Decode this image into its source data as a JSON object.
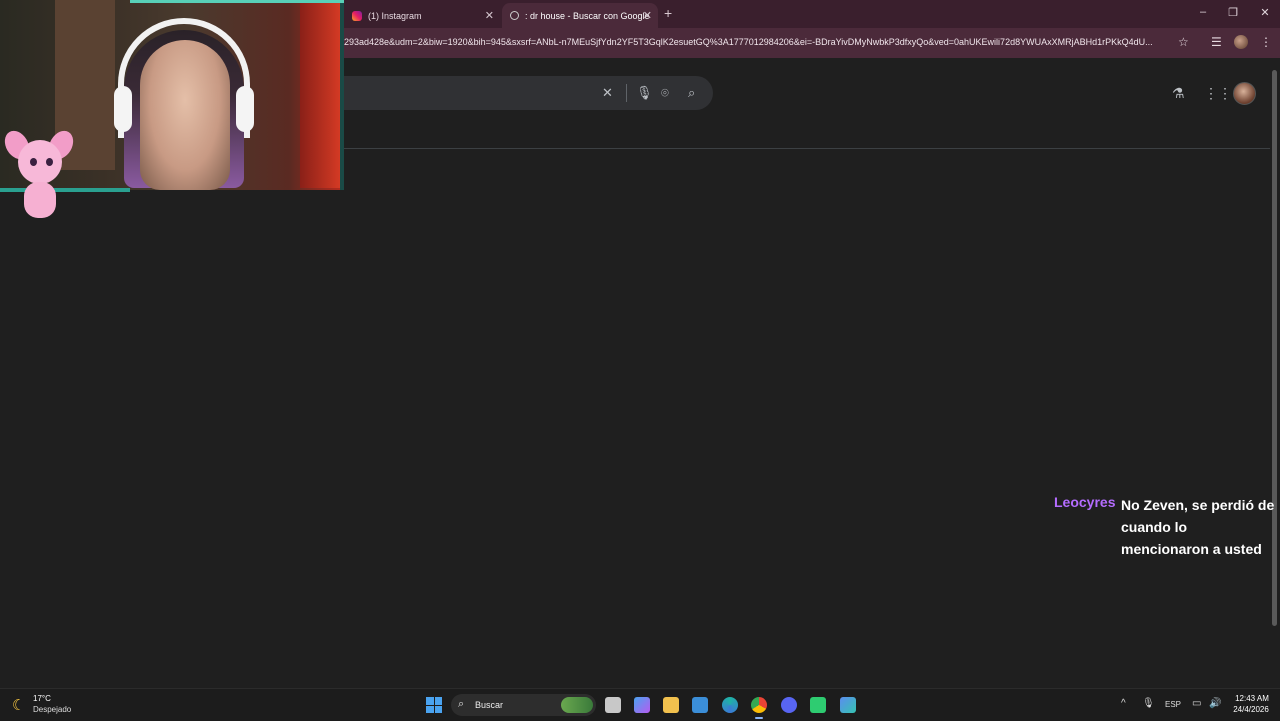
{
  "browser": {
    "tabs": [
      {
        "label": "(1) Instagram",
        "active": false
      },
      {
        "label": ": dr house - Buscar con Google",
        "active": true
      }
    ],
    "new_tab": "+",
    "url": "293ad428e&udm=2&biw=1920&bih=945&sxsrf=ANbL-n7MEuSjfYdn2YF5T3GqlK2esuetGQ%3A1777012984206&ei=-BDraYivDMyNwbkP3dfxyQo&ved=0ahUKEwili72d8YWUAxXMRjABHd1rPKkQ4dU...",
    "window_controls": {
      "minimize": "–",
      "maximize": "❐",
      "close": "✕"
    }
  },
  "search": {
    "clear_icon": "close-icon",
    "voice_icon": "mic-icon",
    "lens_icon": "camera-icon",
    "search_icon": "search-icon"
  },
  "chat": {
    "username": "Leocyres",
    "username_color": "#b46cff",
    "message_lines": [
      "No Zeven, se perdió de",
      "cuando lo",
      "mencionaron a usted"
    ]
  },
  "taskbar": {
    "weather": {
      "temp": "17°C",
      "condition": "Despejado"
    },
    "search_label": "Buscar",
    "language": "ESP",
    "time": "12:43 AM",
    "date": "24/4/2026"
  },
  "colors": {
    "tabbar_bg": "#3a1f2d",
    "address_bg": "#4b2a3a",
    "page_bg": "#1f1f1f",
    "accent": "#58d0b8"
  }
}
